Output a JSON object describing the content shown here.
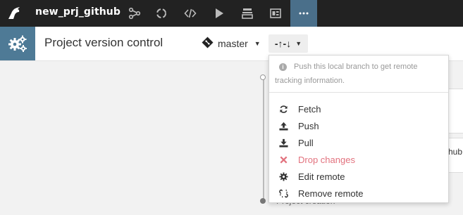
{
  "topbar": {
    "project_name": "new_prj_github",
    "nav_icons": [
      "flow-icon",
      "recycle-icon",
      "code-icon",
      "play-icon",
      "stack-icon",
      "dashboard-icon",
      "more-icon"
    ]
  },
  "subheader": {
    "title": "Project version control",
    "branch": "master",
    "sync_label": "-↑-↓"
  },
  "background": {
    "timeline_label": "Project creation",
    "card_text": "hub"
  },
  "dropdown": {
    "info_text": "Push this local branch to get remote tracking information.",
    "items": [
      {
        "label": "Fetch",
        "icon": "refresh-icon"
      },
      {
        "label": "Push",
        "icon": "upload-icon"
      },
      {
        "label": "Pull",
        "icon": "download-icon"
      },
      {
        "label": "Drop changes",
        "icon": "close-icon"
      },
      {
        "label": "Edit remote",
        "icon": "gear-icon"
      },
      {
        "label": "Remove remote",
        "icon": "unlink-icon"
      }
    ]
  },
  "colors": {
    "topbar_bg": "#222222",
    "accent_active": "#4a6f8a",
    "gear_box": "#4e7a96",
    "danger": "#e2727e"
  }
}
